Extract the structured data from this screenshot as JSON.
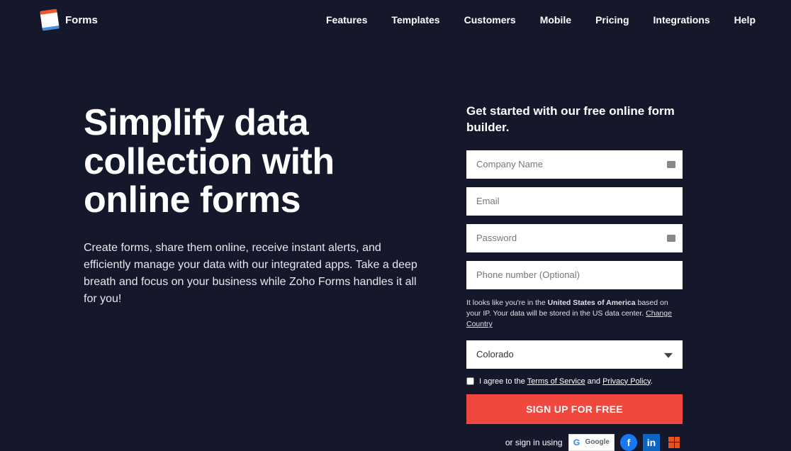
{
  "brand": "Forms",
  "nav": [
    "Features",
    "Templates",
    "Customers",
    "Mobile",
    "Pricing",
    "Integrations",
    "Help"
  ],
  "hero": {
    "title": "Simplify data collection with online forms",
    "subtitle": "Create forms, share them online, receive instant alerts, and efficiently manage your data with our integrated apps. Take a deep breath and focus on your business while Zoho Forms handles it all for you!"
  },
  "form": {
    "heading": "Get started with our free online form builder.",
    "company_ph": "Company Name",
    "email_ph": "Email",
    "password_ph": "Password",
    "phone_ph": "Phone number (Optional)",
    "ip_prefix": "It looks like you're in the ",
    "ip_country": "United States of America",
    "ip_mid": " based on your IP. Your data will be stored in the US data center. ",
    "change_country": "Change Country",
    "state_selected": "Colorado",
    "agree_prefix": "I agree to the ",
    "tos": "Terms of Service",
    "agree_mid": " and ",
    "privacy": "Privacy Policy",
    "agree_suffix": ".",
    "submit": "SIGN UP FOR FREE",
    "social_label": "or sign in using",
    "google": "Google"
  }
}
